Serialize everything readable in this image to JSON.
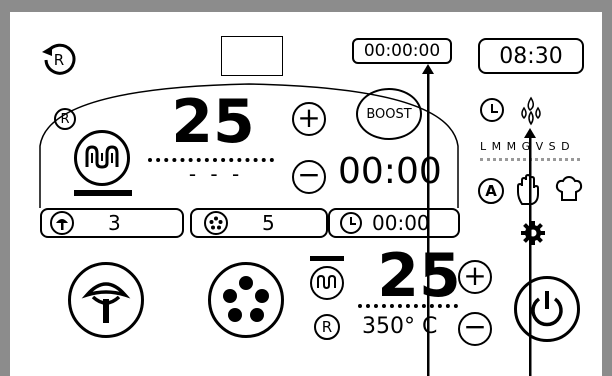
{
  "header": {
    "timer": "00:00:00",
    "clock": "08:30"
  },
  "zone1": {
    "r_badge": "R",
    "temperature": "25",
    "dashes": "- - -",
    "boost_label": "BOOST",
    "time": "00:00"
  },
  "info_row": {
    "mushroom_value": "3",
    "burner_value": "5",
    "timer_value": "00:00"
  },
  "zone2": {
    "temperature": "25",
    "r_badge": "R",
    "temperature_setpoint": "350° C"
  },
  "side": {
    "days": "L M M G V S D",
    "mode_letter": "A"
  },
  "icons": {
    "reset": "reset-r-icon",
    "heater": "heater-coil-icon",
    "mushroom": "mushroom-icon",
    "burner": "burner-icon",
    "clock": "clock-icon",
    "flame": "flame-icon",
    "hand": "hand-icon",
    "chef": "chef-hat-icon",
    "gear": "gear-icon",
    "power": "power-icon"
  }
}
